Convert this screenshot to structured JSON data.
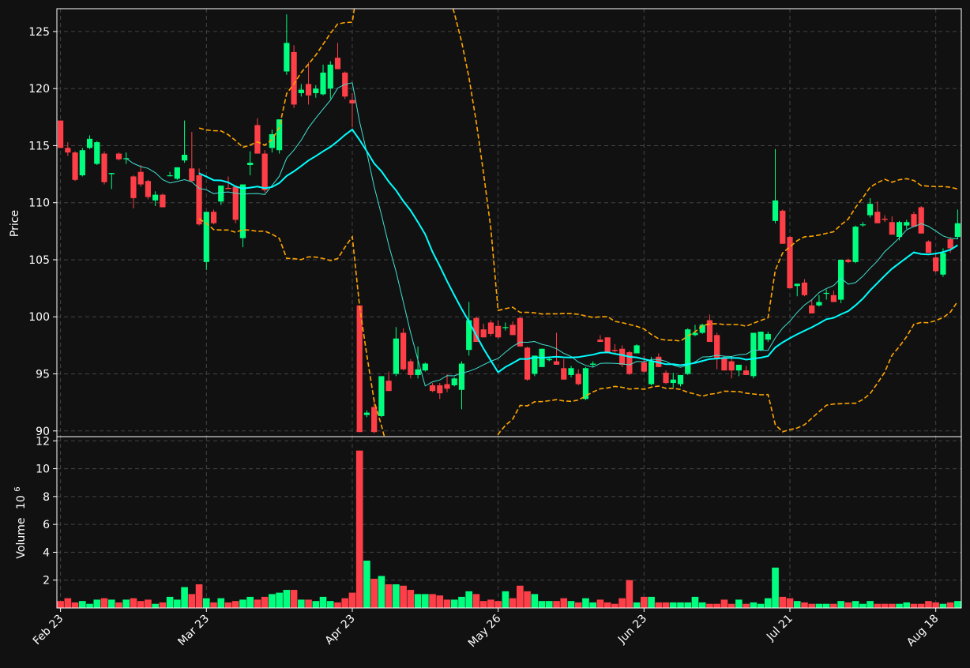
{
  "chart_data": {
    "type": "candlestick",
    "price_ylabel": "Price",
    "volume_ylabel": "Volume",
    "volume_exponent": "10",
    "volume_exponent_power": "6",
    "price_ylim": [
      89.5,
      127
    ],
    "price_yticks": [
      90,
      95,
      100,
      105,
      110,
      115,
      120,
      125
    ],
    "volume_ylim": [
      0,
      12.3
    ],
    "volume_yticks": [
      2,
      4,
      6,
      8,
      10,
      12
    ],
    "xticks": [
      {
        "label": "Feb 23",
        "i": 0
      },
      {
        "label": "Mar 23",
        "i": 20
      },
      {
        "label": "Apr 23",
        "i": 40
      },
      {
        "label": "May 26",
        "i": 60
      },
      {
        "label": "Jun 23",
        "i": 80
      },
      {
        "label": "Jul 21",
        "i": 100
      },
      {
        "label": "Aug 18",
        "i": 120
      }
    ],
    "grid": true,
    "colors": {
      "up": "#00ff7f",
      "down": "#ff3f48",
      "ma_fast": "#40e0d0",
      "ma_slow": "#00ffff",
      "bands": "#ffa500",
      "grid": "#444444",
      "background": "#111111"
    },
    "ohlc": [
      [
        117.2,
        117.2,
        114.8,
        114.8,
        0.5
      ],
      [
        114.8,
        115.3,
        114.1,
        114.4,
        0.7
      ],
      [
        114.4,
        114.5,
        111.9,
        112.0,
        0.4
      ],
      [
        112.4,
        114.8,
        112.3,
        114.6,
        0.5
      ],
      [
        114.8,
        115.9,
        114.7,
        115.6,
        0.3
      ],
      [
        113.4,
        115.4,
        113.3,
        115.3,
        0.6
      ],
      [
        114.3,
        114.5,
        111.6,
        111.8,
        0.7
      ],
      [
        112.5,
        112.6,
        111.2,
        112.6,
        0.6
      ],
      [
        114.3,
        114.4,
        113.7,
        113.8,
        0.4
      ],
      [
        113.9,
        114.4,
        113.4,
        113.9,
        0.6
      ],
      [
        112.3,
        112.4,
        109.5,
        110.4,
        0.7
      ],
      [
        112.7,
        113.3,
        111.4,
        111.6,
        0.5
      ],
      [
        111.9,
        112.0,
        110.3,
        110.5,
        0.6
      ],
      [
        110.2,
        111.0,
        109.7,
        110.7,
        0.3
      ],
      [
        110.7,
        110.8,
        109.6,
        109.6,
        0.4
      ],
      [
        112.4,
        112.7,
        112.3,
        112.4,
        0.8
      ],
      [
        112.1,
        113.1,
        112.0,
        113.1,
        0.6
      ],
      [
        113.7,
        117.2,
        113.5,
        114.2,
        1.5
      ],
      [
        113.0,
        116.2,
        111.8,
        111.9,
        1.0
      ],
      [
        112.4,
        113.0,
        108.0,
        108.1,
        1.7
      ],
      [
        104.8,
        109.2,
        104.1,
        109.2,
        0.7
      ],
      [
        109.2,
        109.4,
        108.1,
        108.2,
        0.4
      ],
      [
        110.1,
        111.5,
        109.8,
        111.5,
        0.7
      ],
      [
        111.3,
        112.3,
        111.2,
        111.2,
        0.4
      ],
      [
        111.4,
        111.5,
        108.2,
        108.5,
        0.5
      ],
      [
        106.9,
        111.6,
        106.1,
        111.6,
        0.6
      ],
      [
        113.3,
        114.5,
        112.4,
        113.5,
        0.8
      ],
      [
        116.8,
        117.4,
        114.3,
        114.3,
        0.6
      ],
      [
        114.3,
        114.6,
        110.9,
        111.1,
        0.8
      ],
      [
        114.8,
        116.4,
        114.4,
        116.0,
        1.0
      ],
      [
        114.6,
        117.3,
        114.3,
        117.3,
        1.1
      ],
      [
        121.5,
        126.5,
        121.2,
        124.0,
        1.3
      ],
      [
        123.2,
        123.8,
        118.3,
        118.6,
        1.3
      ],
      [
        119.6,
        120.4,
        119.3,
        119.9,
        0.6
      ],
      [
        120.4,
        122.3,
        118.6,
        119.4,
        0.6
      ],
      [
        119.6,
        120.3,
        119.2,
        120.0,
        0.5
      ],
      [
        119.5,
        122.1,
        119.4,
        121.4,
        0.8
      ],
      [
        120.0,
        122.4,
        119.1,
        122.1,
        0.5
      ],
      [
        122.7,
        124.0,
        121.7,
        121.7,
        0.4
      ],
      [
        121.4,
        121.5,
        119.1,
        119.3,
        0.7
      ],
      [
        119.0,
        119.6,
        116.6,
        118.7,
        1.1
      ],
      [
        101.0,
        101.0,
        89.9,
        89.9,
        11.3
      ],
      [
        91.4,
        91.8,
        91.2,
        91.6,
        3.4
      ],
      [
        92.1,
        92.9,
        89.8,
        89.9,
        2.1
      ],
      [
        91.3,
        94.8,
        91.2,
        94.8,
        2.3
      ],
      [
        94.4,
        95.2,
        93.5,
        93.5,
        1.7
      ],
      [
        95.0,
        99.1,
        94.8,
        98.1,
        1.7
      ],
      [
        98.6,
        99.0,
        95.3,
        95.4,
        1.6
      ],
      [
        96.1,
        96.3,
        94.6,
        94.9,
        1.3
      ],
      [
        94.9,
        97.4,
        94.6,
        95.4,
        1.0
      ],
      [
        95.3,
        96.0,
        95.2,
        95.9,
        1.0
      ],
      [
        94.0,
        94.2,
        93.4,
        93.5,
        1.0
      ],
      [
        94.0,
        94.2,
        92.8,
        93.3,
        0.9
      ],
      [
        94.1,
        95.0,
        93.4,
        93.7,
        0.6
      ],
      [
        94.0,
        94.7,
        93.9,
        94.6,
        0.6
      ],
      [
        93.6,
        96.1,
        91.9,
        95.9,
        0.8
      ],
      [
        97.1,
        101.3,
        96.6,
        99.7,
        1.2
      ],
      [
        99.9,
        100.0,
        97.8,
        97.8,
        1.0
      ],
      [
        98.9,
        99.4,
        98.8,
        98.2,
        0.5
      ],
      [
        99.5,
        99.7,
        98.3,
        98.5,
        0.6
      ],
      [
        99.2,
        99.7,
        98.1,
        98.2,
        0.5
      ],
      [
        99.1,
        99.5,
        98.8,
        99.1,
        1.2
      ],
      [
        99.3,
        99.6,
        98.4,
        98.4,
        0.7
      ],
      [
        99.9,
        100.0,
        97.4,
        97.4,
        1.6
      ],
      [
        97.3,
        97.4,
        94.4,
        94.5,
        1.2
      ],
      [
        95.0,
        96.6,
        94.8,
        96.6,
        1.0
      ],
      [
        95.6,
        97.2,
        95.6,
        97.2,
        0.5
      ],
      [
        96.2,
        96.4,
        96.1,
        96.3,
        0.5
      ],
      [
        96.1,
        98.6,
        95.8,
        95.8,
        0.5
      ],
      [
        95.5,
        96.3,
        95.3,
        94.5,
        0.7
      ],
      [
        94.9,
        95.7,
        94.7,
        95.5,
        0.5
      ],
      [
        95.0,
        95.4,
        94.0,
        94.1,
        0.4
      ],
      [
        92.8,
        95.6,
        92.7,
        95.5,
        0.7
      ],
      [
        95.8,
        96.1,
        95.6,
        95.9,
        0.4
      ],
      [
        98.0,
        98.4,
        97.8,
        97.8,
        0.6
      ],
      [
        98.2,
        98.2,
        96.8,
        96.8,
        0.4
      ],
      [
        97.1,
        97.6,
        96.8,
        97.0,
        0.3
      ],
      [
        97.2,
        97.5,
        95.6,
        95.8,
        0.7
      ],
      [
        96.9,
        97.0,
        94.9,
        95.0,
        2.0
      ],
      [
        96.8,
        97.6,
        96.8,
        97.5,
        0.4
      ],
      [
        96.0,
        96.6,
        95.1,
        95.2,
        0.8
      ],
      [
        94.1,
        96.5,
        94.0,
        96.1,
        0.8
      ],
      [
        96.5,
        96.8,
        95.6,
        95.6,
        0.4
      ],
      [
        95.1,
        95.3,
        94.1,
        94.2,
        0.4
      ],
      [
        94.2,
        95.1,
        93.8,
        94.5,
        0.4
      ],
      [
        94.1,
        94.9,
        93.9,
        94.9,
        0.4
      ],
      [
        95.0,
        99.0,
        94.9,
        98.9,
        0.4
      ],
      [
        98.4,
        99.3,
        98.3,
        98.6,
        0.8
      ],
      [
        98.6,
        99.4,
        98.5,
        99.3,
        0.4
      ],
      [
        99.7,
        100.2,
        97.8,
        97.8,
        0.3
      ],
      [
        98.4,
        98.6,
        95.4,
        96.4,
        0.3
      ],
      [
        96.4,
        96.6,
        95.3,
        95.3,
        0.6
      ],
      [
        96.1,
        96.5,
        94.6,
        95.3,
        0.3
      ],
      [
        95.3,
        95.8,
        94.8,
        95.8,
        0.6
      ],
      [
        95.3,
        95.7,
        94.9,
        94.9,
        0.3
      ],
      [
        94.8,
        98.2,
        94.6,
        98.6,
        0.4
      ],
      [
        97.1,
        98.7,
        97.0,
        98.7,
        0.3
      ],
      [
        98.0,
        98.7,
        97.8,
        98.5,
        0.7
      ],
      [
        108.4,
        114.7,
        108.2,
        110.2,
        2.9
      ],
      [
        109.3,
        109.4,
        106.4,
        106.4,
        0.8
      ],
      [
        107.0,
        107.1,
        102.5,
        102.5,
        0.7
      ],
      [
        102.7,
        102.9,
        101.8,
        102.9,
        0.5
      ],
      [
        103.0,
        103.3,
        101.8,
        101.9,
        0.4
      ],
      [
        101.0,
        101.5,
        100.3,
        100.3,
        0.3
      ],
      [
        101.0,
        101.9,
        100.9,
        101.3,
        0.3
      ],
      [
        102.1,
        102.4,
        101.5,
        102.1,
        0.3
      ],
      [
        101.9,
        102.3,
        101.3,
        101.3,
        0.3
      ],
      [
        101.5,
        105.0,
        101.2,
        105.0,
        0.5
      ],
      [
        105.0,
        105.1,
        104.7,
        104.8,
        0.4
      ],
      [
        104.8,
        108.0,
        104.7,
        107.9,
        0.5
      ],
      [
        108.1,
        108.3,
        107.9,
        108.1,
        0.3
      ],
      [
        108.9,
        110.4,
        108.7,
        109.9,
        0.5
      ],
      [
        109.2,
        110.1,
        108.2,
        108.2,
        0.3
      ],
      [
        108.6,
        108.9,
        108.3,
        108.5,
        0.3
      ],
      [
        108.3,
        108.8,
        107.2,
        107.2,
        0.3
      ],
      [
        107.0,
        108.4,
        106.7,
        108.3,
        0.3
      ],
      [
        108.0,
        108.5,
        107.7,
        108.3,
        0.4
      ],
      [
        109.0,
        109.2,
        107.9,
        107.9,
        0.3
      ],
      [
        109.6,
        109.7,
        107.3,
        107.3,
        0.3
      ],
      [
        106.6,
        106.7,
        105.6,
        105.6,
        0.5
      ],
      [
        105.2,
        105.6,
        103.9,
        104.0,
        0.4
      ],
      [
        103.7,
        106.0,
        103.5,
        105.6,
        0.3
      ],
      [
        106.8,
        107.0,
        105.6,
        106.0,
        0.4
      ],
      [
        107.0,
        109.4,
        106.8,
        108.2,
        0.5
      ]
    ]
  }
}
